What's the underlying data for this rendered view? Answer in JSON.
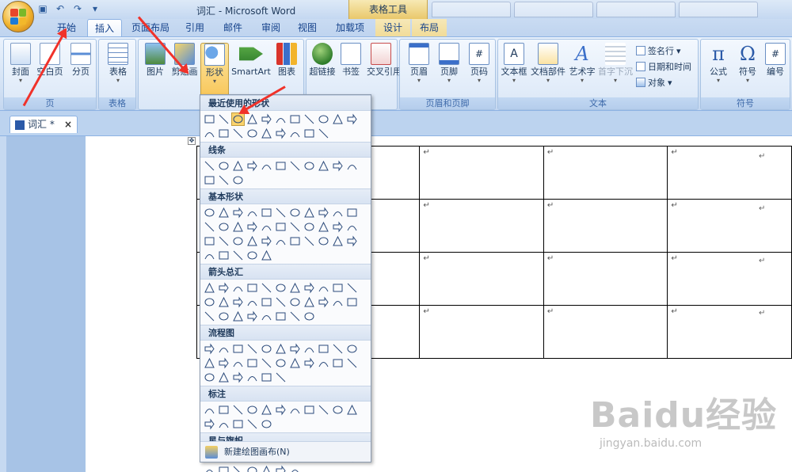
{
  "window": {
    "title": "词汇 - Microsoft Word",
    "context_tab_title": "表格工具"
  },
  "tabs": [
    {
      "label": "开始"
    },
    {
      "label": "插入"
    },
    {
      "label": "页面布局"
    },
    {
      "label": "引用"
    },
    {
      "label": "邮件"
    },
    {
      "label": "审阅"
    },
    {
      "label": "视图"
    },
    {
      "label": "加载项"
    },
    {
      "label": "设计"
    },
    {
      "label": "布局"
    }
  ],
  "ribbon": {
    "groups": {
      "page": {
        "label": "页",
        "buttons": [
          "封面",
          "空白页",
          "分页"
        ]
      },
      "table": {
        "label": "表格",
        "buttons": [
          "表格"
        ]
      },
      "illustrations": {
        "buttons": [
          "图片",
          "剪贴画",
          "形状",
          "SmartArt",
          "图表"
        ]
      },
      "links": {
        "buttons": [
          "超链接",
          "书签",
          "交叉引用"
        ]
      },
      "header_footer": {
        "label": "页眉和页脚",
        "buttons": [
          "页眉",
          "页脚",
          "页码"
        ]
      },
      "text": {
        "label": "文本",
        "buttons": [
          "文本框",
          "文档部件",
          "艺术字",
          "首字下沉"
        ],
        "small": [
          "签名行",
          "日期和时间",
          "对象"
        ]
      },
      "symbols": {
        "label": "符号",
        "buttons": [
          "公式",
          "符号",
          "编号"
        ]
      }
    }
  },
  "document_tab": {
    "label": "词汇 *",
    "close": "×"
  },
  "shapes_menu": {
    "sections": [
      "最近使用的形状",
      "线条",
      "基本形状",
      "箭头总汇",
      "流程图",
      "标注",
      "星与旗帜"
    ],
    "footer": "新建绘图画布(N)"
  },
  "table_cell_mark": "↵",
  "watermark": {
    "brand": "Baidu经验",
    "url": "jingyan.baidu.com"
  }
}
